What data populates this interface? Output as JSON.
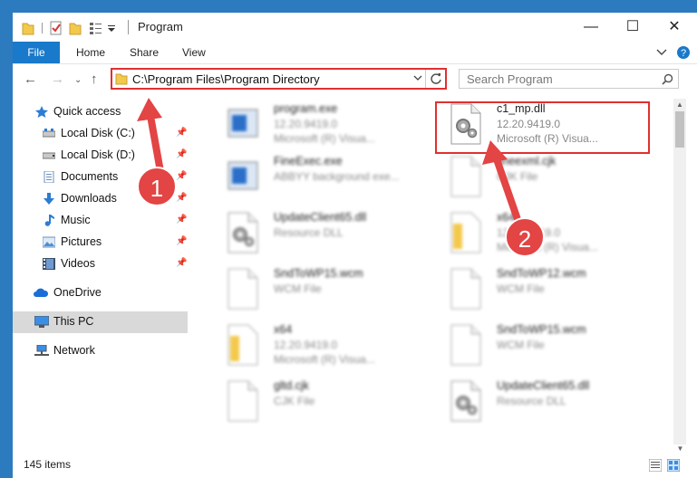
{
  "window": {
    "title": "Program",
    "controls": {
      "minimize": "—",
      "maximize": "☐",
      "close": "✕"
    }
  },
  "ribbon": {
    "file": "File",
    "tabs": [
      "Home",
      "Share",
      "View"
    ],
    "expand_icon": "chevron-down-icon",
    "help_icon": "help-icon"
  },
  "navigation": {
    "address": "C:\\Program Files\\Program Directory",
    "search_placeholder": "Search Program"
  },
  "sidebar": {
    "items": [
      {
        "label": "Quick access",
        "icon": "star-icon"
      },
      {
        "label": "Local Disk (C:)",
        "icon": "drive-icon",
        "pinned": true
      },
      {
        "label": "Local Disk (D:)",
        "icon": "drive-icon",
        "pinned": true
      },
      {
        "label": "Documents",
        "icon": "documents-icon",
        "pinned": true
      },
      {
        "label": "Downloads",
        "icon": "downloads-icon",
        "pinned": true
      },
      {
        "label": "Music",
        "icon": "music-icon",
        "pinned": true
      },
      {
        "label": "Pictures",
        "icon": "pictures-icon",
        "pinned": true
      },
      {
        "label": "Videos",
        "icon": "videos-icon",
        "pinned": true
      },
      {
        "label": "OneDrive",
        "icon": "cloud-icon"
      },
      {
        "label": "This PC",
        "icon": "computer-icon",
        "selected": true
      },
      {
        "label": "Network",
        "icon": "network-icon"
      }
    ]
  },
  "files": [
    {
      "name": "program.exe",
      "line1": "12.20.9419.0",
      "line2": "Microsoft (R) Visua...",
      "icon": "exe-icon"
    },
    {
      "name": "c1_mp.dll",
      "line1": "12.20.9419.0",
      "line2": "Microsoft (R) Visua...",
      "icon": "dll-gear-icon"
    },
    {
      "name": "FineExec.exe",
      "line1": "ABBYY background exe...",
      "line2": "",
      "icon": "exe-icon"
    },
    {
      "name": "fineexml.cjk",
      "line1": "CJK File",
      "line2": "",
      "icon": "file-icon"
    },
    {
      "name": "UpdateClient65.dll",
      "line1": "Resource DLL",
      "line2": "",
      "icon": "dll-gear-icon"
    },
    {
      "name": "x64",
      "line1": "12.20.9419.0",
      "line2": "Microsoft (R) Visua...",
      "icon": "folder-file-icon"
    },
    {
      "name": "SndToWP15.wcm",
      "line1": "WCM File",
      "line2": "",
      "icon": "file-icon"
    },
    {
      "name": "SndToWP12.wcm",
      "line1": "WCM File",
      "line2": "",
      "icon": "file-icon"
    },
    {
      "name": "x64",
      "line1": "12.20.9419.0",
      "line2": "Microsoft (R) Visua...",
      "icon": "folder-file-icon"
    },
    {
      "name": "SndToWP15.wcm",
      "line1": "WCM File",
      "line2": "",
      "icon": "file-icon"
    },
    {
      "name": "gltd.cjk",
      "line1": "CJK File",
      "line2": "",
      "icon": "file-icon"
    },
    {
      "name": "UpdateClient65.dll",
      "line1": "Resource DLL",
      "line2": "",
      "icon": "dll-gear-icon"
    }
  ],
  "status": {
    "items_count": "145 items"
  },
  "annotations": [
    {
      "label": "1"
    },
    {
      "label": "2"
    }
  ]
}
